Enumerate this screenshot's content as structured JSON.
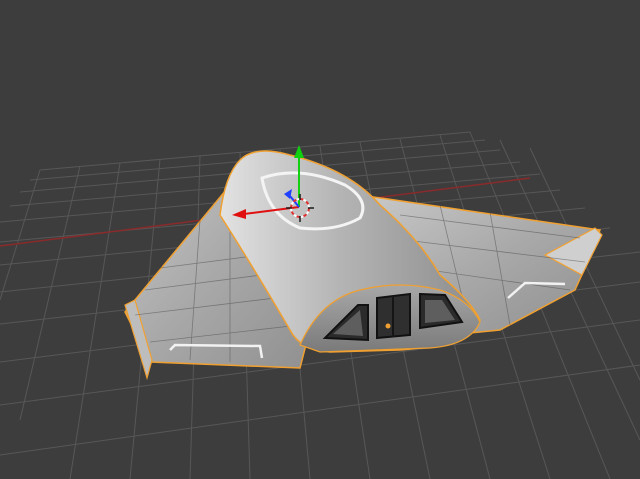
{
  "viewport": {
    "background": "#3d3d3d",
    "grid_color": "#5a5a5a",
    "x_axis_color": "#8a2a2a",
    "selection_outline_color": "#f0a030",
    "model_color": "#b9b9b9",
    "manipulator": {
      "x_axis_color": "#e01010",
      "y_axis_color": "#10d010",
      "z_axis_color": "#2040ff"
    },
    "icons": [
      "3d-cursor-icon",
      "transform-manipulator-icon"
    ]
  }
}
